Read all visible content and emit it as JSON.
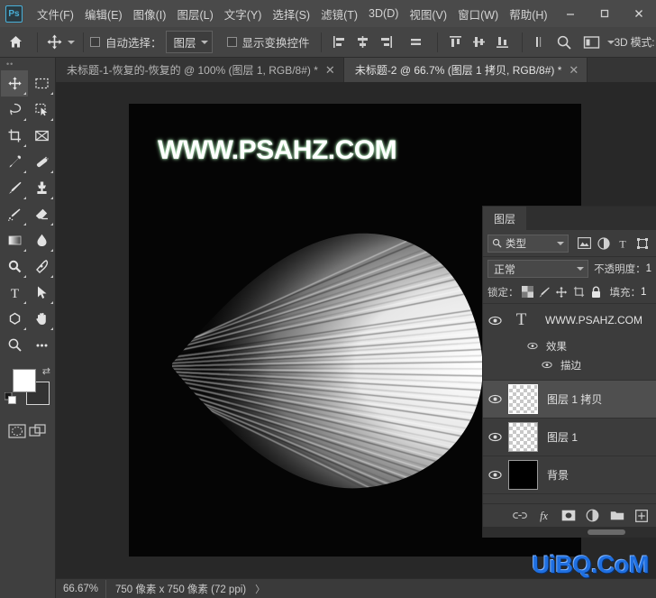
{
  "app": {
    "logo": "Ps",
    "title": "Adobe Photoshop"
  },
  "menubar": {
    "items": [
      {
        "label": "文件(F)",
        "name": "menu-file"
      },
      {
        "label": "编辑(E)",
        "name": "menu-edit"
      },
      {
        "label": "图像(I)",
        "name": "menu-image"
      },
      {
        "label": "图层(L)",
        "name": "menu-layer"
      },
      {
        "label": "文字(Y)",
        "name": "menu-type"
      },
      {
        "label": "选择(S)",
        "name": "menu-select"
      },
      {
        "label": "滤镜(T)",
        "name": "menu-filter"
      },
      {
        "label": "3D(D)",
        "name": "menu-3d"
      },
      {
        "label": "视图(V)",
        "name": "menu-view"
      },
      {
        "label": "窗口(W)",
        "name": "menu-window"
      },
      {
        "label": "帮助(H)",
        "name": "menu-help"
      }
    ],
    "window_controls": {
      "minimize": "—",
      "maximize": "▫",
      "close": "✕"
    }
  },
  "options_bar": {
    "home_icon": "home-icon",
    "active_tool": "move-tool",
    "auto_select_checked": false,
    "auto_select_label": "自动选择：",
    "auto_select_value": "图层",
    "show_transform_checked": false,
    "show_transform_label": "显示变换控件",
    "mode_3d_label": "3D 模式:"
  },
  "toolbar": {
    "tools": [
      {
        "name": "move-tool",
        "glyph": "move",
        "active": true
      },
      {
        "name": "rectangular-marquee-tool",
        "glyph": "marquee",
        "active": false
      },
      {
        "name": "lasso-tool",
        "glyph": "lasso",
        "active": false
      },
      {
        "name": "quick-selection-tool",
        "glyph": "quickselect",
        "active": false
      },
      {
        "name": "crop-tool",
        "glyph": "crop",
        "active": false
      },
      {
        "name": "frame-tool",
        "glyph": "frame",
        "active": false
      },
      {
        "name": "eyedropper-tool",
        "glyph": "eyedropper",
        "active": false
      },
      {
        "name": "spot-healing-brush-tool",
        "glyph": "healing",
        "active": false
      },
      {
        "name": "brush-tool",
        "glyph": "brush",
        "active": false
      },
      {
        "name": "clone-stamp-tool",
        "glyph": "stamp",
        "active": false
      },
      {
        "name": "history-brush-tool",
        "glyph": "historybrush",
        "active": false
      },
      {
        "name": "eraser-tool",
        "glyph": "eraser",
        "active": false
      },
      {
        "name": "gradient-tool",
        "glyph": "gradient",
        "active": false
      },
      {
        "name": "blur-tool",
        "glyph": "blur",
        "active": false
      },
      {
        "name": "dodge-tool",
        "glyph": "dodge",
        "active": false
      },
      {
        "name": "pen-tool",
        "glyph": "pen",
        "active": false
      },
      {
        "name": "horizontal-type-tool",
        "glyph": "type",
        "active": false
      },
      {
        "name": "path-selection-tool",
        "glyph": "pathselect",
        "active": false
      },
      {
        "name": "polygon-shape-tool",
        "glyph": "polygon",
        "active": false
      },
      {
        "name": "hand-tool",
        "glyph": "hand",
        "active": false
      },
      {
        "name": "zoom-tool",
        "glyph": "zoom",
        "active": false
      },
      {
        "name": "edit-toolbar-tool",
        "glyph": "ellipsis",
        "active": false
      }
    ],
    "foreground_color": "#ffffff",
    "background_color": "#333333"
  },
  "document_tabs": [
    {
      "label": "未标题-1-恢复的-恢复的 @ 100% (图层 1, RGB/8#) *",
      "close": "✕",
      "active": false,
      "name": "doc-tab-untitled-1"
    },
    {
      "label": "未标题-2 @ 66.7% (图层 1 拷贝, RGB/8#) *",
      "close": "✕",
      "active": true,
      "name": "doc-tab-untitled-2"
    }
  ],
  "canvas": {
    "watermark_text": "WWW.PSAHZ.COM",
    "background_color": "#050505",
    "artwork": "radial-light-burst"
  },
  "status_bar": {
    "zoom": "66.67%",
    "dimensions": "750 像素 x 750 像素 (72 ppi)",
    "arrow": "〉"
  },
  "overlay_watermark": "UiBQ.CoM",
  "layers_panel": {
    "tab_label": "图层",
    "filter": {
      "search_icon": "search-icon",
      "kind_label": "类型",
      "icons": [
        {
          "name": "filter-pixel-icon"
        },
        {
          "name": "filter-adjustment-icon"
        },
        {
          "name": "filter-type-icon"
        },
        {
          "name": "filter-shape-icon"
        }
      ]
    },
    "blend_mode": "正常",
    "opacity_label": "不透明度：",
    "opacity_value": "1",
    "lock_label": "锁定：",
    "fill_label": "填充：",
    "fill_value": "1",
    "lock_icons": [
      {
        "name": "lock-transparent-pixels-icon"
      },
      {
        "name": "lock-image-pixels-icon"
      },
      {
        "name": "lock-position-icon"
      },
      {
        "name": "lock-artboard-nesting-icon"
      },
      {
        "name": "lock-all-icon"
      }
    ],
    "layers": [
      {
        "name": "WWW.PSAHZ.COM",
        "type": "text",
        "visible": true,
        "selected": false,
        "effects": {
          "label": "效果",
          "items": [
            {
              "label": "描边",
              "visible": true
            }
          ]
        }
      },
      {
        "name": "图层 1 拷贝",
        "type": "pixel-transparent",
        "visible": true,
        "selected": true
      },
      {
        "name": "图层 1",
        "type": "pixel-transparent",
        "visible": true,
        "selected": false
      },
      {
        "name": "背景",
        "type": "pixel-black",
        "visible": true,
        "selected": false
      }
    ],
    "bottom_buttons": [
      {
        "name": "link-layers-button",
        "glyph": "link"
      },
      {
        "name": "add-layer-style-button",
        "glyph": "fx"
      },
      {
        "name": "add-layer-mask-button",
        "glyph": "mask"
      },
      {
        "name": "new-fill-adjustment-layer-button",
        "glyph": "adjust"
      },
      {
        "name": "new-group-button",
        "glyph": "folder"
      },
      {
        "name": "new-layer-button",
        "glyph": "new"
      }
    ]
  },
  "colors": {
    "menu_bg": "#4a4a4a",
    "options_bg": "#444444",
    "panel_bg": "#3c3c3c",
    "canvas_bg": "#282828",
    "toolbar_bg": "#3f3f3f",
    "text": "#d3d3d3",
    "accent": "#49b0d8",
    "watermark_blue": "#1f6fe0"
  }
}
